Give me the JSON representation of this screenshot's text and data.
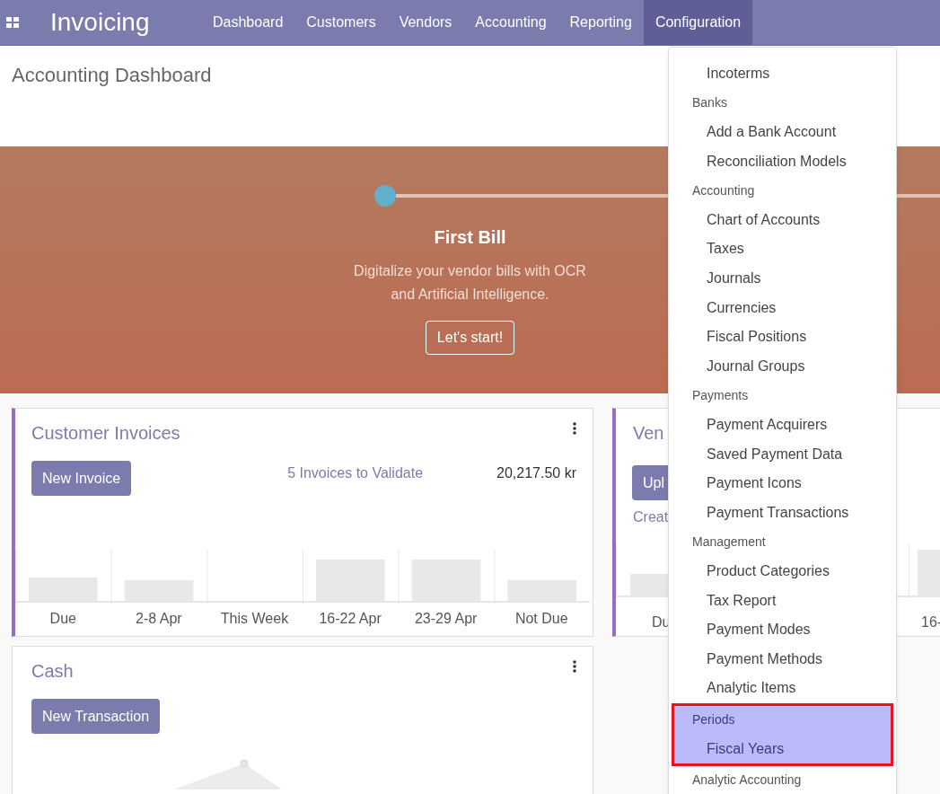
{
  "app": {
    "title": "Invoicing"
  },
  "nav": [
    {
      "label": "Dashboard",
      "selected": false
    },
    {
      "label": "Customers",
      "selected": false
    },
    {
      "label": "Vendors",
      "selected": false
    },
    {
      "label": "Accounting",
      "selected": false
    },
    {
      "label": "Reporting",
      "selected": false
    },
    {
      "label": "Configuration",
      "selected": true
    }
  ],
  "page_title": "Accounting Dashboard",
  "banner": {
    "step_title": "First Bill",
    "description": "Digitalize your vendor bills with OCR and Artificial Intelligence.",
    "button": "Let's start!"
  },
  "customer_invoices": {
    "title": "Customer Invoices",
    "button": "New Invoice",
    "link": "5 Invoices to Validate",
    "amount": "20,217.50 kr",
    "chart_labels": [
      "Due",
      "2-8 Apr",
      "This Week",
      "16-22 Apr",
      "23-29 Apr",
      "Not Due"
    ]
  },
  "vendor_card": {
    "title": "Ven",
    "button": "Upl",
    "link": "Creat",
    "chart_labels": [
      "Du",
      "16-"
    ]
  },
  "cash": {
    "title": "Cash",
    "button": "New Transaction"
  },
  "menu": [
    {
      "kind": "item",
      "label": "Incoterms",
      "highlighted": false
    },
    {
      "kind": "header",
      "label": "Banks",
      "highlighted": false
    },
    {
      "kind": "item",
      "label": "Add a Bank Account",
      "highlighted": false
    },
    {
      "kind": "item",
      "label": "Reconciliation Models",
      "highlighted": false
    },
    {
      "kind": "header",
      "label": "Accounting",
      "highlighted": false
    },
    {
      "kind": "item",
      "label": "Chart of Accounts",
      "highlighted": false
    },
    {
      "kind": "item",
      "label": "Taxes",
      "highlighted": false
    },
    {
      "kind": "item",
      "label": "Journals",
      "highlighted": false
    },
    {
      "kind": "item",
      "label": "Currencies",
      "highlighted": false
    },
    {
      "kind": "item",
      "label": "Fiscal Positions",
      "highlighted": false
    },
    {
      "kind": "item",
      "label": "Journal Groups",
      "highlighted": false
    },
    {
      "kind": "header",
      "label": "Payments",
      "highlighted": false
    },
    {
      "kind": "item",
      "label": "Payment Acquirers",
      "highlighted": false
    },
    {
      "kind": "item",
      "label": "Saved Payment Data",
      "highlighted": false
    },
    {
      "kind": "item",
      "label": "Payment Icons",
      "highlighted": false
    },
    {
      "kind": "item",
      "label": "Payment Transactions",
      "highlighted": false
    },
    {
      "kind": "header",
      "label": "Management",
      "highlighted": false
    },
    {
      "kind": "item",
      "label": "Product Categories",
      "highlighted": false
    },
    {
      "kind": "item",
      "label": "Tax Report",
      "highlighted": false
    },
    {
      "kind": "item",
      "label": "Payment Modes",
      "highlighted": false
    },
    {
      "kind": "item",
      "label": "Payment Methods",
      "highlighted": false
    },
    {
      "kind": "item",
      "label": "Analytic Items",
      "highlighted": false
    },
    {
      "kind": "header",
      "label": "Periods",
      "highlighted": true
    },
    {
      "kind": "item",
      "label": "Fiscal Years",
      "highlighted": true
    },
    {
      "kind": "header",
      "label": "Analytic Accounting",
      "highlighted": false
    }
  ]
}
